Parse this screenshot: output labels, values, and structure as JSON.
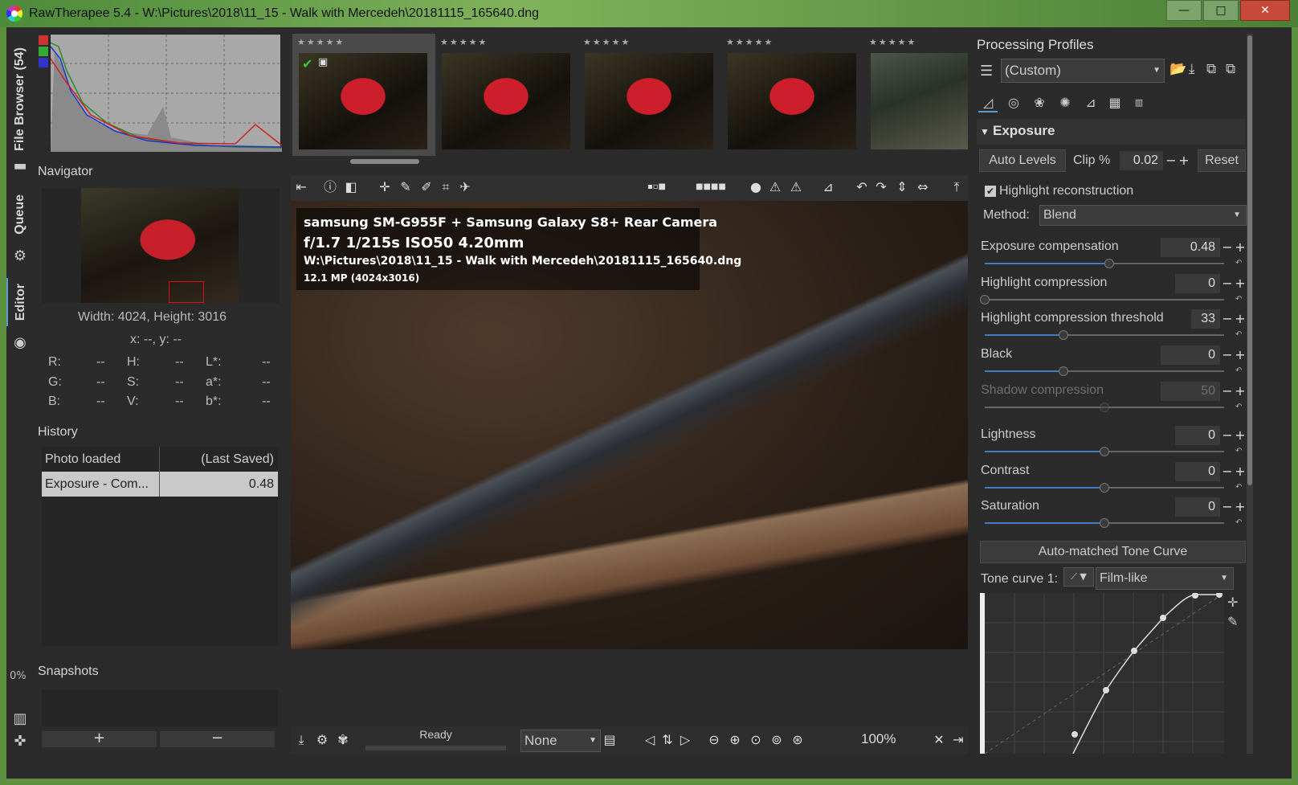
{
  "window": {
    "title": "RawTherapee 5.4 - W:\\Pictures\\2018\\11_15 - Walk with Mercedeh\\20181115_165640.dng",
    "minimize": "—",
    "maximize": "□",
    "close": "✕"
  },
  "vtabs": {
    "file_browser": "File Browser (54)",
    "queue": "Queue",
    "editor": "Editor",
    "progress": "0%"
  },
  "navigator": {
    "title": "Navigator",
    "size": "Width: 4024, Height: 3016",
    "coords": "x: --, y: --",
    "readouts": [
      {
        "k": "R:",
        "v": "--"
      },
      {
        "k": "H:",
        "v": "--"
      },
      {
        "k": "L*:",
        "v": "--"
      },
      {
        "k": "G:",
        "v": "--"
      },
      {
        "k": "S:",
        "v": "--"
      },
      {
        "k": "a*:",
        "v": "--"
      },
      {
        "k": "B:",
        "v": "--"
      },
      {
        "k": "V:",
        "v": "--"
      },
      {
        "k": "b*:",
        "v": "--"
      }
    ]
  },
  "history": {
    "title": "History",
    "rows": [
      {
        "action": "Photo loaded",
        "value": "(Last Saved)"
      },
      {
        "action": "Exposure - Com...",
        "value": "0.48"
      }
    ]
  },
  "snapshots": {
    "title": "Snapshots",
    "add": "+",
    "remove": "−"
  },
  "filmstrip": {
    "thumbs": [
      {
        "stars": "★★★★★"
      },
      {
        "stars": "★★★★★"
      },
      {
        "stars": "★★★★★"
      },
      {
        "stars": "★★★★★"
      },
      {
        "stars": "★★★★★"
      }
    ]
  },
  "overlay": {
    "camera": "samsung SM-G955F + Samsung Galaxy S8+ Rear Camera",
    "exposure": "f/1.7  1/215s  ISO50  4.20mm",
    "path": "W:\\Pictures\\2018\\11_15 - Walk with Mercedeh\\20181115_165640.dng",
    "mp": "12.1 MP (4024x3016)"
  },
  "status": {
    "ready": "Ready",
    "preview_mode": "None",
    "zoom": "100%"
  },
  "profiles": {
    "title": "Processing Profiles",
    "selected": "(Custom)"
  },
  "exposure": {
    "section_title": "Exposure",
    "auto_levels": "Auto Levels",
    "clip_label": "Clip %",
    "clip_value": "0.02",
    "reset": "Reset",
    "highlight_reconstruction": "Highlight reconstruction",
    "method_label": "Method:",
    "method_value": "Blend",
    "sliders": [
      {
        "label": "Exposure compensation",
        "value": "0.48",
        "level": 0.52
      },
      {
        "label": "Highlight compression",
        "value": "0",
        "level": 0.0
      },
      {
        "label": "Highlight compression threshold",
        "value": "33",
        "level": 0.33
      },
      {
        "label": "Black",
        "value": "0",
        "level": 0.33
      },
      {
        "label": "Shadow compression",
        "value": "50",
        "level": 0.5
      },
      {
        "label": "Lightness",
        "value": "0",
        "level": 0.5
      },
      {
        "label": "Contrast",
        "value": "0",
        "level": 0.5
      },
      {
        "label": "Saturation",
        "value": "0",
        "level": 0.5
      }
    ],
    "tone_curve_button": "Auto-matched Tone Curve",
    "tone_curve_label": "Tone curve 1:",
    "tone_curve_mode": "Film-like"
  }
}
